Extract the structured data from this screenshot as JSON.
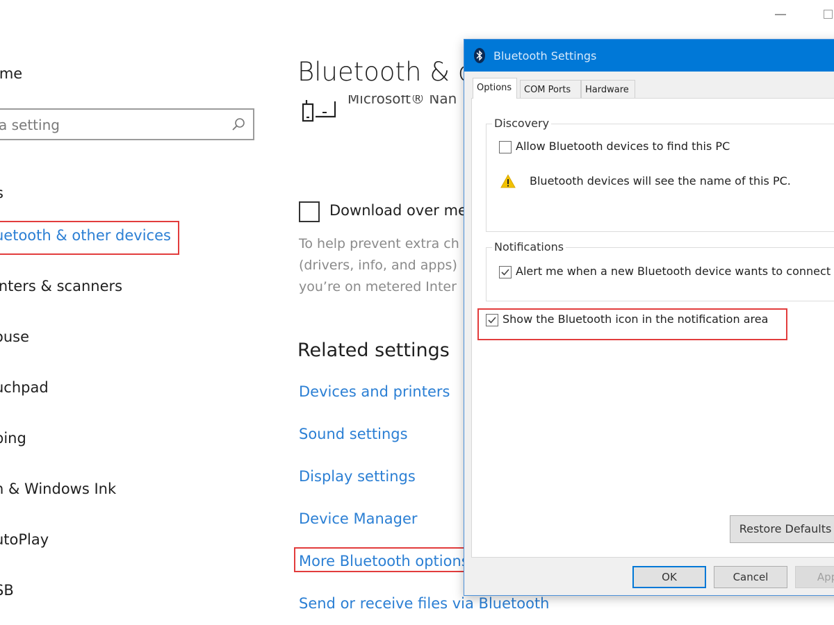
{
  "window": {
    "controls": [
      "minimize",
      "maximize"
    ]
  },
  "sidebar": {
    "home_label": "ome",
    "search": {
      "placeholder": "a setting",
      "icon": "search-icon"
    },
    "section_fragment": "s",
    "items": [
      {
        "label": "uetooth & other devices",
        "active": true,
        "highlighted": true
      },
      {
        "label": "inters & scanners",
        "active": false
      },
      {
        "label": "ouse",
        "active": false
      },
      {
        "label": "uchpad",
        "active": false
      },
      {
        "label": "ping",
        "active": false
      },
      {
        "label": "n & Windows Ink",
        "active": false
      },
      {
        "label": "utoPlay",
        "active": false
      },
      {
        "label": "SB",
        "active": false
      }
    ]
  },
  "main": {
    "title": "Bluetooth & o",
    "device": {
      "name": "Microsoft® Nan",
      "icon": "device-icon"
    },
    "download_option": {
      "label": "Download over me",
      "checked": false,
      "description": [
        "To help prevent extra ch",
        "(drivers, info, and apps)",
        "you’re on metered Inter"
      ]
    },
    "related_settings": {
      "heading": "Related settings",
      "links": [
        {
          "label": "Devices and printers"
        },
        {
          "label": "Sound settings"
        },
        {
          "label": "Display settings"
        },
        {
          "label": "Device Manager"
        },
        {
          "label": "More Bluetooth options",
          "highlighted": true
        },
        {
          "label": "Send or receive files via Bluetooth"
        }
      ]
    }
  },
  "dialog": {
    "title": "Bluetooth Settings",
    "icon": "bluetooth-icon",
    "tabs": [
      {
        "label": "Options",
        "active": true
      },
      {
        "label": "COM Ports",
        "active": false
      },
      {
        "label": "Hardware",
        "active": false
      }
    ],
    "discovery": {
      "label": "Discovery",
      "allow_find": {
        "label": "Allow Bluetooth devices to find this PC",
        "checked": false
      },
      "warning": "Bluetooth devices will see the name of this PC."
    },
    "notifications": {
      "label": "Notifications",
      "alert_connect": {
        "label": "Alert me when a new Bluetooth device wants to connect",
        "checked": true
      }
    },
    "show_icon": {
      "label": "Show the Bluetooth icon in the notification area",
      "checked": true,
      "highlighted": true
    },
    "buttons": {
      "restore_defaults": "Restore Defaults",
      "ok": "OK",
      "cancel": "Cancel",
      "apply": "Apply"
    }
  },
  "colors": {
    "accent": "#0078d7",
    "link": "#2b7fd4",
    "highlight_box": "#e23c3c",
    "warning": "#f2c200"
  }
}
